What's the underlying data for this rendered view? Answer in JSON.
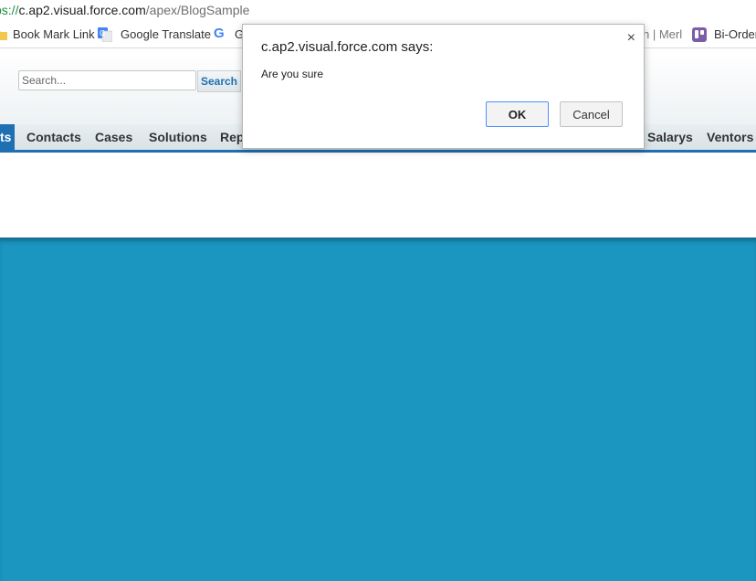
{
  "browser": {
    "address": {
      "scheme": "ps://",
      "host": "c.ap2.visual.force.com",
      "path": "/apex/BlogSample"
    },
    "bookmarks": {
      "bookmark_link": "Book Mark Link",
      "google_translate": "Google Translate",
      "g_item": "G",
      "partial_item": "n | Merl",
      "bi_order": "Bi-Order"
    }
  },
  "salesforce": {
    "search": {
      "placeholder": "Search...",
      "button_label": "Search"
    },
    "tabs": {
      "active_partial": "ts",
      "contacts": "Contacts",
      "cases": "Cases",
      "solutions": "Solutions",
      "reports_partial": "Rep",
      "salarys": "Salarys",
      "ventors": "Ventors"
    },
    "colors": {
      "tab_accent": "#1f6fb3",
      "content_band": "#1a96c1"
    }
  },
  "dialog": {
    "title": "c.ap2.visual.force.com says:",
    "message": "Are you sure",
    "ok_label": "OK",
    "cancel_label": "Cancel",
    "close_glyph": "×"
  }
}
